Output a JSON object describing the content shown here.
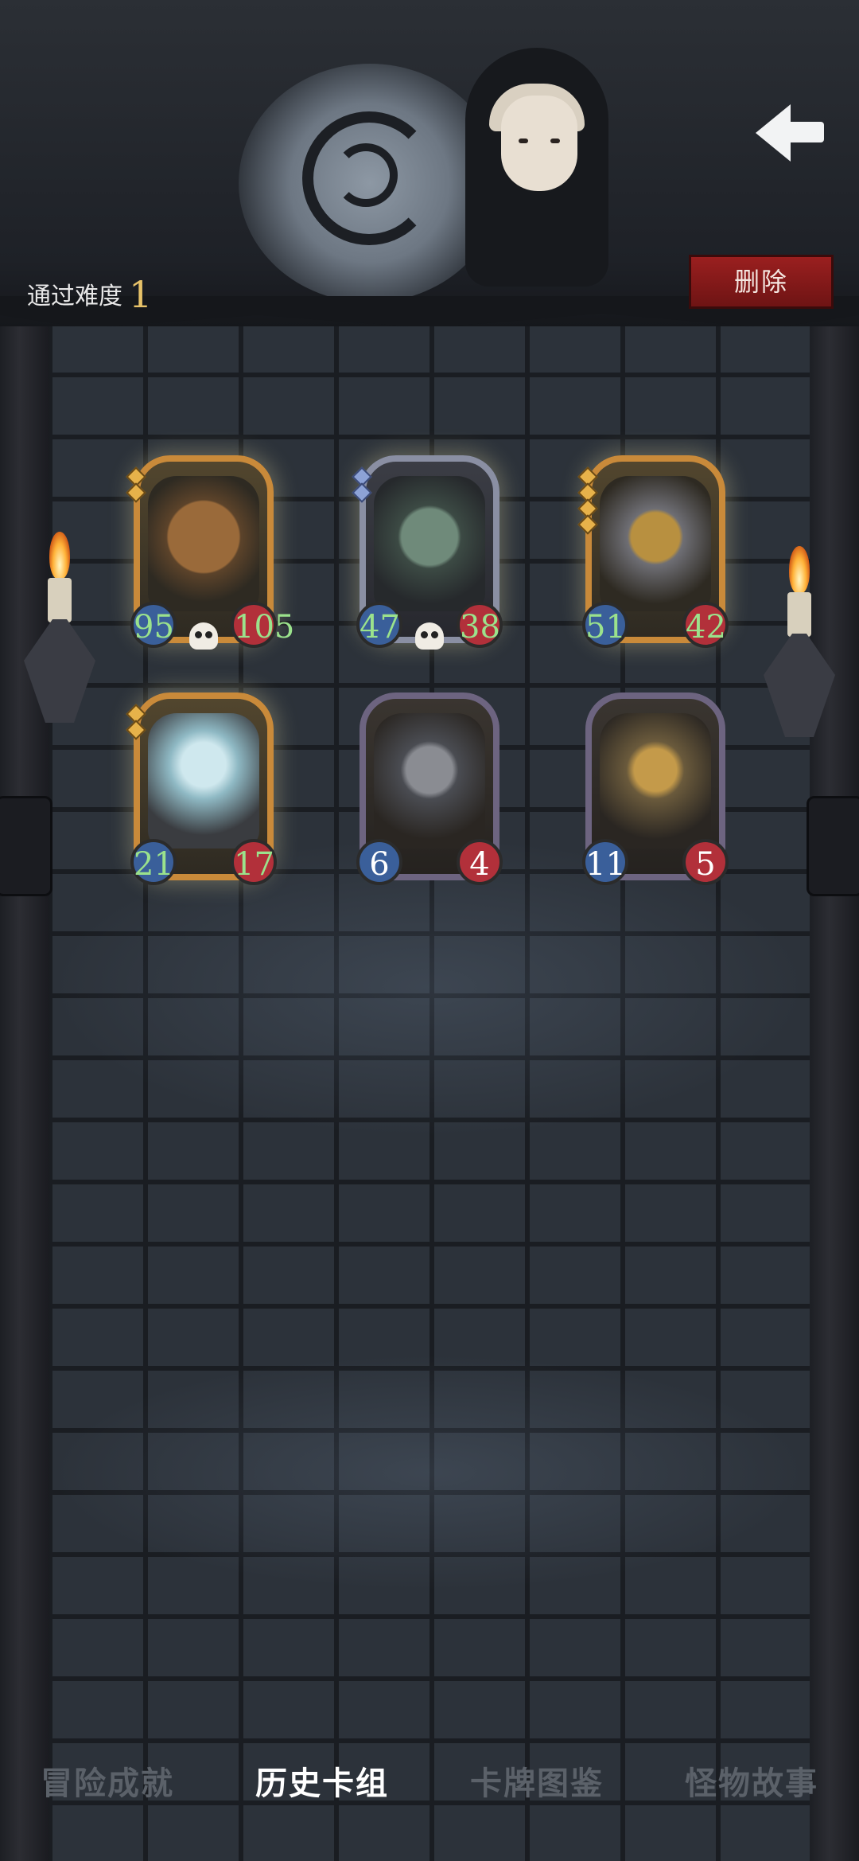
{
  "header": {
    "difficulty_label": "通过难度",
    "difficulty_value": "1",
    "delete_label": "删除"
  },
  "cards": [
    {
      "name": "bear",
      "attack": "95",
      "health": "105",
      "frame": "gold",
      "gems": 2
    },
    {
      "name": "knight",
      "attack": "47",
      "health": "38",
      "frame": "silver",
      "gems": 2
    },
    {
      "name": "golden-armor",
      "attack": "51",
      "health": "42",
      "frame": "gold",
      "gems": 4
    },
    {
      "name": "fish-tank",
      "attack": "21",
      "health": "17",
      "frame": "gold",
      "gems": 2
    },
    {
      "name": "tin-robot",
      "attack": "6",
      "health": "4",
      "frame": "purple",
      "gems": 0
    },
    {
      "name": "brass-robot",
      "attack": "11",
      "health": "5",
      "frame": "purple",
      "gems": 0
    }
  ],
  "tabs": [
    {
      "label": "冒险成就",
      "active": false
    },
    {
      "label": "历史卡组",
      "active": true
    },
    {
      "label": "卡牌图鉴",
      "active": false
    },
    {
      "label": "怪物故事",
      "active": false
    }
  ],
  "colors": {
    "delete_button": "#8a1c1c",
    "frame_gold": "#c98a3a",
    "frame_silver": "#8a8fa3",
    "frame_purple": "#6d6480",
    "stat_attack": "#3a5f9a",
    "stat_health": "#b2303a",
    "boosted_text": "#9be28c"
  }
}
